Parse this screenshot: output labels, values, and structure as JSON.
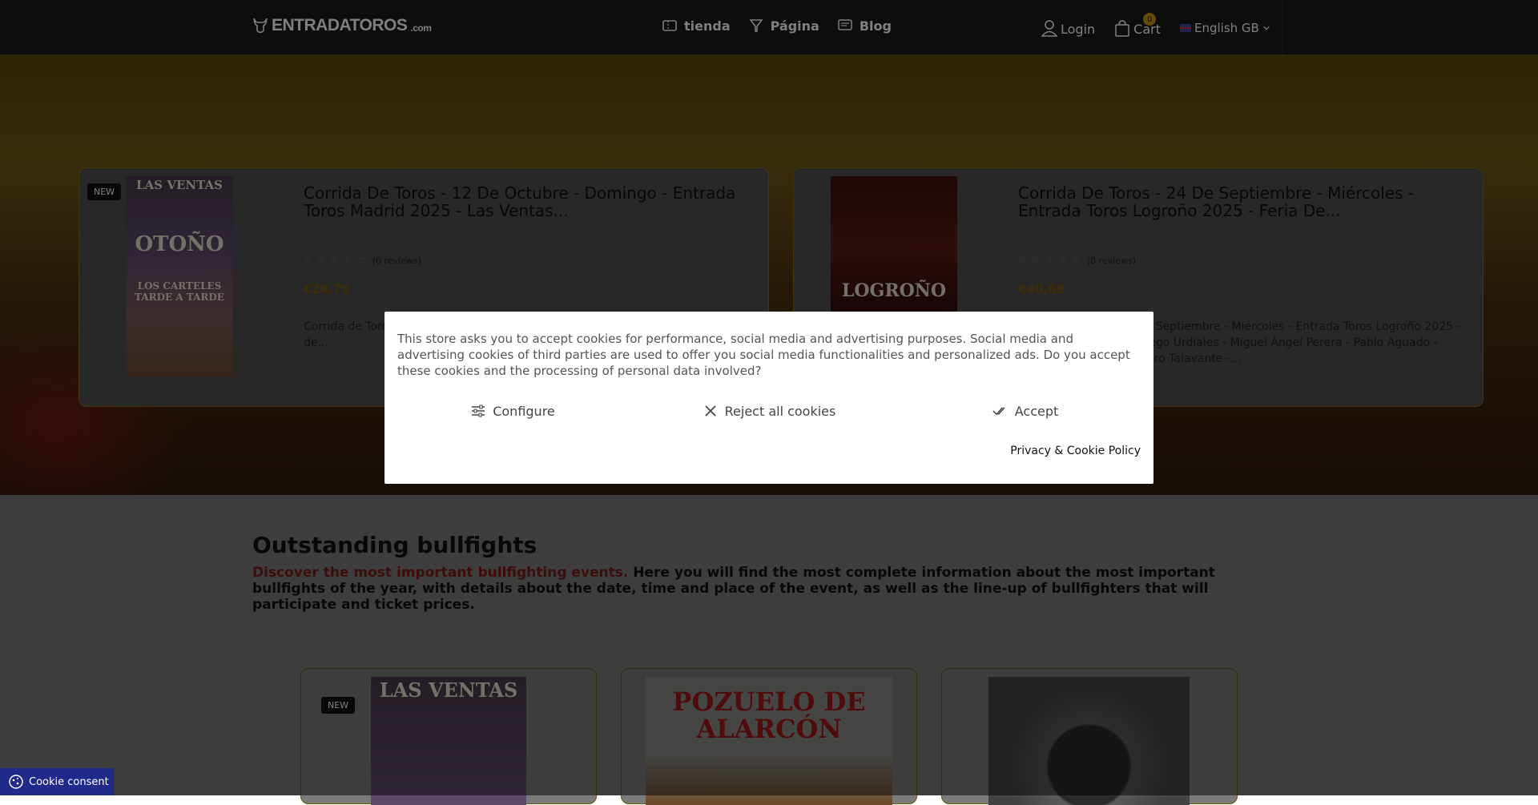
{
  "header": {
    "logo_text": "ENTRADATOROS",
    "logo_suffix": ".com",
    "nav": [
      {
        "label": "tienda",
        "icon": "ticket-icon"
      },
      {
        "label": "Página",
        "icon": "cup-icon"
      },
      {
        "label": "Blog",
        "icon": "blog-icon"
      }
    ],
    "login_label": "Login",
    "cart_label": "Cart",
    "cart_count": "0",
    "language": "English GB"
  },
  "featured": [
    {
      "badge": "NEW",
      "title": "Corrida De Toros - 12 De Octubre - Domingo - Entrada Toros Madrid 2025 - Las Ventas...",
      "reviews": "(0 reviews)",
      "price": "€28.70",
      "description": "Corrida de Toros - 12 de Octubre - Domingo - Entrada Toros Madrid 2025 - Feria de...",
      "poster": {
        "line1": "LAS VENTAS",
        "line2": "OTOÑO",
        "line3": "LOS CARTELES TARDE A TARDE"
      }
    },
    {
      "badge": "",
      "title": "Corrida De Toros - 24 De Septiembre - Miércoles - Entrada Toros Logroño 2025 - Feria De...",
      "reviews": "(0 reviews)",
      "price": "€40.69",
      "description": "Corrida de Toros - 24 de Septiembre - Miércoles - Entrada Toros Logroño 2025 - Feria de San Mateo - Diego Urdiales - Miguel Ángel Perera - Pablo Aguado - Emilio de Justo - Alejandro Talavante -...",
      "poster": {
        "line1": "",
        "line2": "LOGROÑO",
        "line3": ""
      }
    }
  ],
  "section": {
    "title": "Outstanding bullfights",
    "highlight": "Discover the most important bullfighting events.",
    "text": " Here you will find the most complete information about the most important bullfights of the year, with details about the date, time and place of the event, as well as the line-up of bullfighters that will participate and ticket prices."
  },
  "grid_cards": [
    {
      "badge": "NEW",
      "poster_text": "LAS VENTAS"
    },
    {
      "badge": "",
      "poster_text": "POZUELO DE ALARCÓN"
    },
    {
      "badge": "",
      "poster_text": ""
    }
  ],
  "cookie_modal": {
    "text": "This store asks you to accept cookies for performance, social media and advertising purposes. Social media and advertising cookies of third parties are used to offer you social media functionalities and personalized ads. Do you accept these cookies and the processing of personal data involved?",
    "configure_label": "Configure",
    "reject_label": "Reject all cookies",
    "accept_label": "Accept",
    "policy_label": "Privacy & Cookie Policy"
  },
  "cookie_tab_label": "Cookie consent",
  "colors": {
    "accent_gold": "#c79b18",
    "highlight_red": "#c0302a",
    "cookie_tab_blue": "#2a3bc8"
  }
}
